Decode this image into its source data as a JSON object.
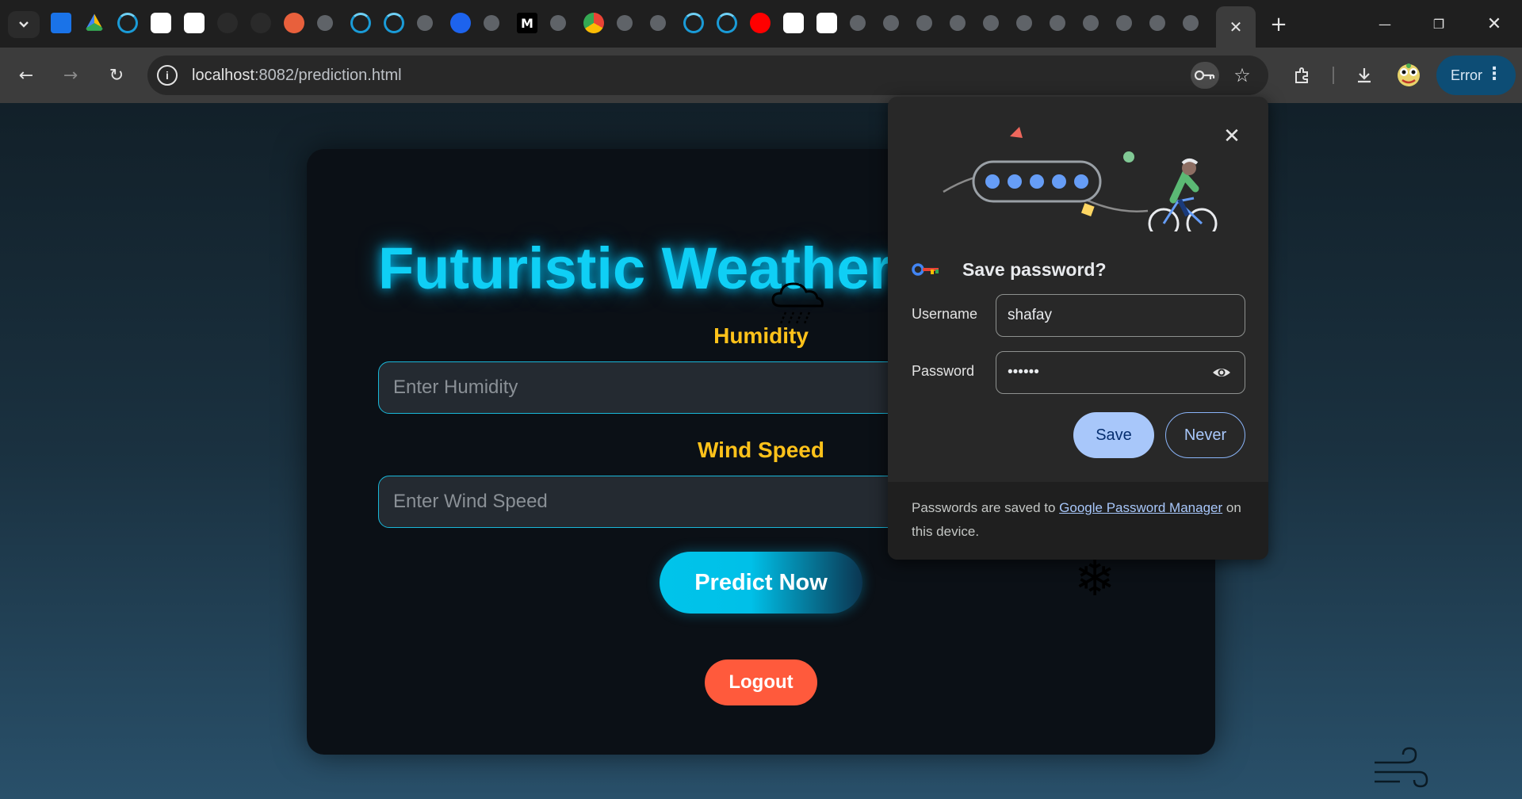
{
  "browser": {
    "tab_search_icon": "chevron-down-icon",
    "active_tab_close": "✕",
    "new_tab_label": "+",
    "window_controls": {
      "minimize": "—",
      "restore": "❐",
      "close": "✕"
    },
    "nav": {
      "back": "←",
      "forward": "→",
      "reload": "↻"
    },
    "url_host": "localhost",
    "url_rest": ":8082/prediction.html",
    "bookmark_star": "☆",
    "profile_error_label": "Error",
    "profile_menu": "⋮",
    "tab_favicons": [
      "contacts-icon",
      "google-drive-icon",
      "loading-icon",
      "chatgpt-icon",
      "chatgpt-icon",
      "blank-icon",
      "blank-icon",
      "app-icon",
      "globe-icon",
      "loading-icon",
      "loading-icon",
      "globe-icon",
      "docker-icon",
      "globe-icon",
      "medium-icon",
      "globe-icon",
      "chrome-icon",
      "globe-icon",
      "globe-icon",
      "loading-icon",
      "loading-icon",
      "youtube-icon",
      "chatgpt-icon",
      "chatgpt-icon",
      "globe-icon",
      "globe-icon",
      "globe-icon",
      "globe-icon",
      "globe-icon",
      "globe-icon",
      "globe-icon",
      "globe-icon",
      "globe-icon",
      "globe-icon",
      "globe-icon"
    ],
    "medium_label": "M",
    "colors": {
      "accent": "#0d4d75"
    }
  },
  "page": {
    "title": "Futuristic Weather",
    "humidity_label": "Humidity",
    "humidity_placeholder": "Enter Humidity",
    "wind_label": "Wind Speed",
    "wind_placeholder": "Enter Wind Speed",
    "predict_button": "Predict Now",
    "logout_button": "Logout",
    "snowflake_glyph": "❄",
    "colors": {
      "title": "#0fcff5",
      "label": "#ffc21a",
      "logout": "#ff5a3c"
    }
  },
  "password_popup": {
    "title": "Save password?",
    "username_label": "Username",
    "username_value": "shafay",
    "password_label": "Password",
    "password_value": "••••••",
    "save_button": "Save",
    "never_button": "Never",
    "footer_prefix": "Passwords are saved to ",
    "footer_link": "Google Password Manager",
    "footer_suffix": " on this device.",
    "close_glyph": "✕"
  }
}
